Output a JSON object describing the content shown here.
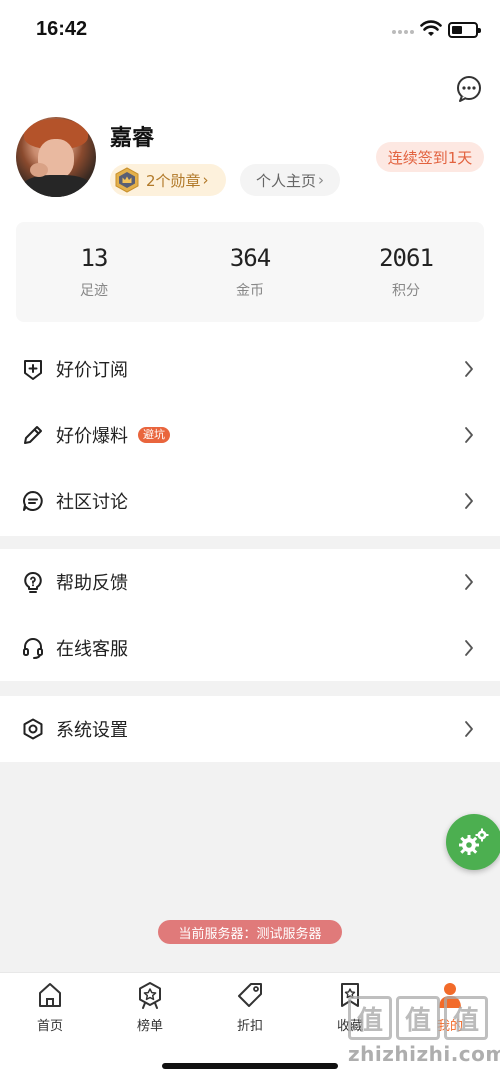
{
  "status_bar": {
    "time": "16:42"
  },
  "profile": {
    "name": "嘉睿",
    "badges_label": "2个勋章",
    "homepage_label": "个人主页",
    "checkin_label": "连续签到1天"
  },
  "stats": [
    {
      "value": "13",
      "label": "足迹"
    },
    {
      "value": "364",
      "label": "金币"
    },
    {
      "value": "2061",
      "label": "积分"
    }
  ],
  "menu_group1": [
    {
      "label": "好价订阅",
      "icon": "plus-shield-icon"
    },
    {
      "label": "好价爆料",
      "icon": "pencil-icon",
      "tag": "避坑"
    },
    {
      "label": "社区讨论",
      "icon": "chat-bubble-icon"
    }
  ],
  "menu_group2": [
    {
      "label": "帮助反馈",
      "icon": "help-bulb-icon"
    },
    {
      "label": "在线客服",
      "icon": "headset-icon"
    }
  ],
  "menu_group3": [
    {
      "label": "系统设置",
      "icon": "gear-hex-icon"
    }
  ],
  "server_label": "当前服务器：测试服务器",
  "tabs": [
    {
      "label": "首页",
      "icon": "home-icon"
    },
    {
      "label": "榜单",
      "icon": "ranking-badge-icon"
    },
    {
      "label": "折扣",
      "icon": "price-tag-icon"
    },
    {
      "label": "收藏",
      "icon": "bookmark-star-icon"
    },
    {
      "label": "我的",
      "icon": "person-icon",
      "active": true
    }
  ],
  "watermark": {
    "logo_text": "值",
    "url": "zhizhizhi.com"
  },
  "colors": {
    "accent": "#f26b2a",
    "checkin_text": "#e2623f",
    "tag_bg": "#e9653d",
    "fab": "#4caf50",
    "server_pill": "#e07a7a"
  }
}
